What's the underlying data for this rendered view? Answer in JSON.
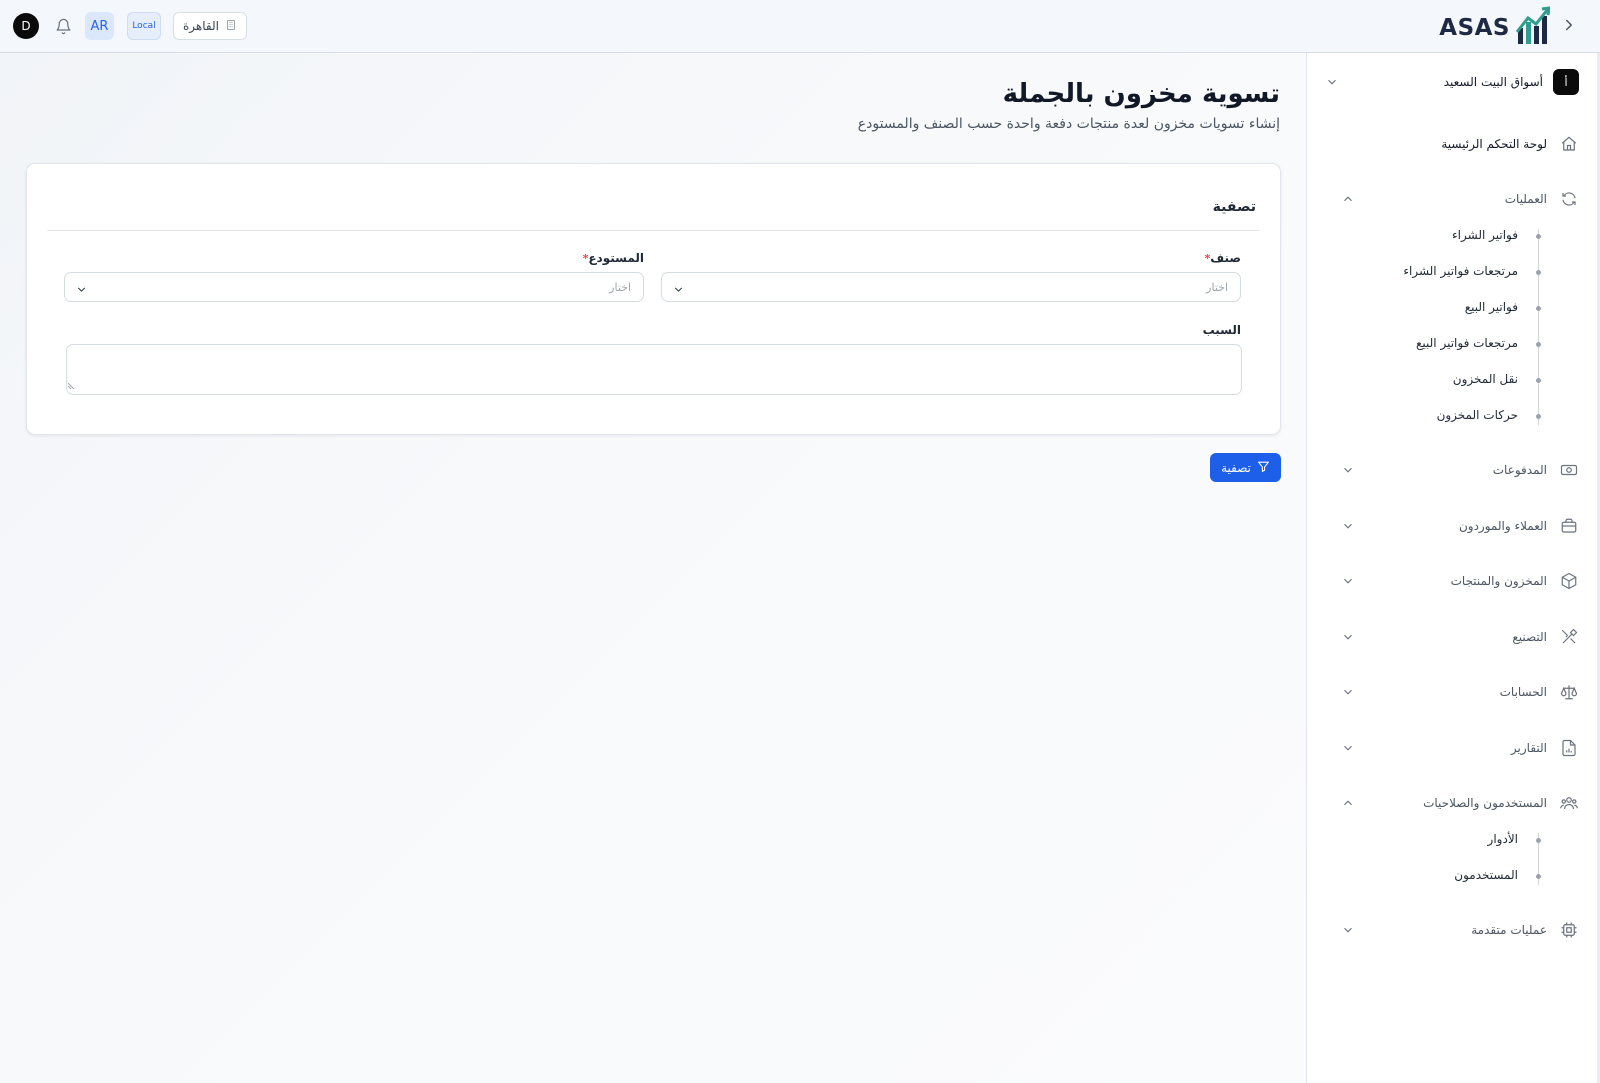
{
  "header": {
    "avatar_initial": "D",
    "lang_label": "AR",
    "env_label": "Local",
    "branch_label": "القاهرة",
    "logo_text": "ASAS"
  },
  "sidebar": {
    "store_badge": "أ",
    "store_name": "أسواق البيت السعيد",
    "items": [
      {
        "label": "لوحة التحكم الرئيسية",
        "icon": "home-icon"
      },
      {
        "label": "العمليات",
        "icon": "refresh-icon",
        "expanded": true
      },
      {
        "label": "المدفوعات",
        "icon": "cash-icon"
      },
      {
        "label": "العملاء والموردون",
        "icon": "briefcase-icon"
      },
      {
        "label": "المخزون والمنتجات",
        "icon": "box-icon"
      },
      {
        "label": "التصنيع",
        "icon": "tools-icon"
      },
      {
        "label": "الحسابات",
        "icon": "scale-icon"
      },
      {
        "label": "التقارير",
        "icon": "report-icon"
      },
      {
        "label": "المستخدمون والصلاحيات",
        "icon": "users-icon",
        "expanded": true
      },
      {
        "label": "عمليات متقدمة",
        "icon": "chip-icon"
      }
    ],
    "operations_sub": [
      "فواتير الشراء",
      "مرتجعات فواتير الشراء",
      "فواتير البيع",
      "مرتجعات فواتير البيع",
      "نقل المخزون",
      "حركات المخزون"
    ],
    "users_sub": [
      "الأدوار",
      "المستخدمون"
    ]
  },
  "main": {
    "title": "تسوية مخزون بالجملة",
    "subtitle": "إنشاء تسويات مخزون لعدة منتجات دفعة واحدة حسب الصنف والمستودع",
    "card_title": "تصفية",
    "category_label": "صنف",
    "category_placeholder": "اختار",
    "warehouse_label": "المستودع",
    "warehouse_placeholder": "اختار",
    "required_mark": "*",
    "reason_label": "السبب",
    "filter_button": "تصفية"
  },
  "colors": {
    "primary": "#1d5fe8",
    "header_bg": "#f4f7fb",
    "lang_bg": "#dbe7fb"
  }
}
